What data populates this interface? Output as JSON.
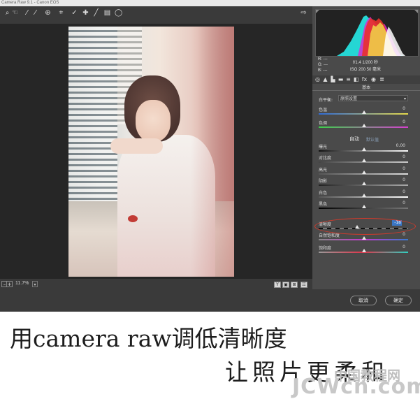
{
  "window": {
    "title": "Camera Raw 9.1 - Canon EOS"
  },
  "toolbar": {
    "tools": [
      {
        "name": "zoom-icon",
        "glyph": "🔍"
      },
      {
        "name": "hand-icon",
        "glyph": "✋"
      },
      {
        "name": "eyedropper-icon",
        "glyph": "⁄"
      },
      {
        "name": "color-sampler-icon",
        "glyph": "⁄"
      },
      {
        "name": "targeted-adjust-icon",
        "glyph": "⊕"
      },
      {
        "name": "crop-icon",
        "glyph": "⌗"
      },
      {
        "name": "straighten-icon",
        "glyph": "⟋"
      },
      {
        "name": "spot-removal-icon",
        "glyph": "⊹"
      },
      {
        "name": "brush-icon",
        "glyph": "╱"
      },
      {
        "name": "graduated-filter-icon",
        "glyph": "▤"
      },
      {
        "name": "radial-filter-icon",
        "glyph": "◯"
      }
    ],
    "export_icon": "⇨"
  },
  "statusbar": {
    "zoom": "11.7%"
  },
  "view_buttons": [
    "Y",
    "▣",
    "⊞",
    "☷"
  ],
  "panel": {
    "meta_left": [
      "R: ---",
      "G: ---",
      "B: ---"
    ],
    "meta_right_1": "f/1.4  1/200 秒",
    "meta_right_2": "ISO 200   50 毫米",
    "section_title": "基本",
    "white_balance_label": "白平衡:",
    "white_balance_value": "原照设置",
    "auto_label": "自动",
    "default_label": "默认值",
    "rows": [
      {
        "label": "色温",
        "value": "0"
      },
      {
        "label": "色调",
        "value": "0"
      },
      {
        "label": "曝光",
        "value": "0.00"
      },
      {
        "label": "对比度",
        "value": "0"
      },
      {
        "label": "高光",
        "value": "0"
      },
      {
        "label": "阴影",
        "value": "0"
      },
      {
        "label": "白色",
        "value": "0"
      },
      {
        "label": "黑色",
        "value": "0"
      },
      {
        "label": "清晰度",
        "value": "-18"
      },
      {
        "label": "自然饱和度",
        "value": "0"
      },
      {
        "label": "饱和度",
        "value": "0"
      }
    ],
    "tab_icons": [
      "◎",
      "▲",
      "▙",
      "▬",
      "≡",
      "◧",
      "fx",
      "◉",
      "≣"
    ]
  },
  "footer": {
    "cancel": "取消",
    "ok": "确定"
  },
  "caption": {
    "line1": "用camera raw调低清晰度",
    "line2": "让照片更柔和"
  },
  "watermark": {
    "site_cn": "中国教程网",
    "site_en": "JCWcn.com"
  },
  "colors": {
    "accent_blue": "#3b76c4",
    "highlight_red": "#d23a2b"
  }
}
